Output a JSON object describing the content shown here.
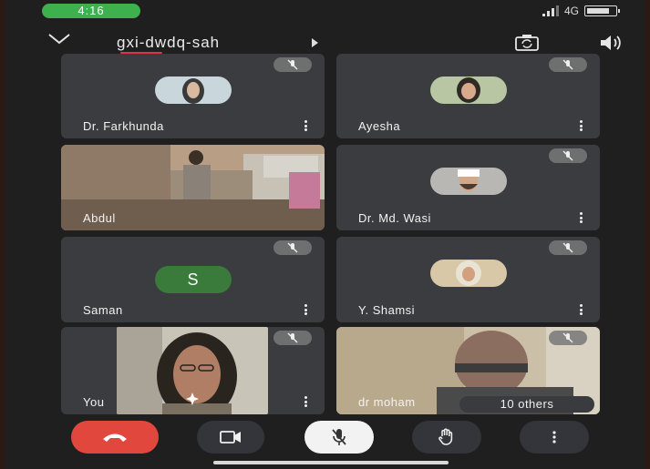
{
  "status_bar": {
    "time": "4:16",
    "network": "4G"
  },
  "meeting": {
    "code": "gxi-dwdq-sah"
  },
  "tiles": [
    {
      "name": "Dr. Farkhunda",
      "kind": "avatar-photo"
    },
    {
      "name": "Ayesha",
      "kind": "avatar-photo"
    },
    {
      "name": "Abdul",
      "kind": "video"
    },
    {
      "name": "Dr. Md. Wasi",
      "kind": "avatar-photo"
    },
    {
      "name": "Saman",
      "kind": "avatar-letter",
      "letter": "S"
    },
    {
      "name": "Y. Shamsi",
      "kind": "avatar-photo"
    },
    {
      "name": "You",
      "kind": "self"
    },
    {
      "name": "dr moham",
      "kind": "video"
    }
  ],
  "others_pill": "10 others",
  "controls": {
    "end_call": "end-call-icon",
    "video": "video-icon",
    "mic": "mic-off-icon",
    "hand": "raise-hand-icon",
    "more": "more-vert-icon"
  },
  "colors": {
    "end_call": "#e2473d",
    "time_pill": "#3fb04e",
    "letter_avatar": "#3a7a3a",
    "tile_bg": "#3b3c3f"
  }
}
